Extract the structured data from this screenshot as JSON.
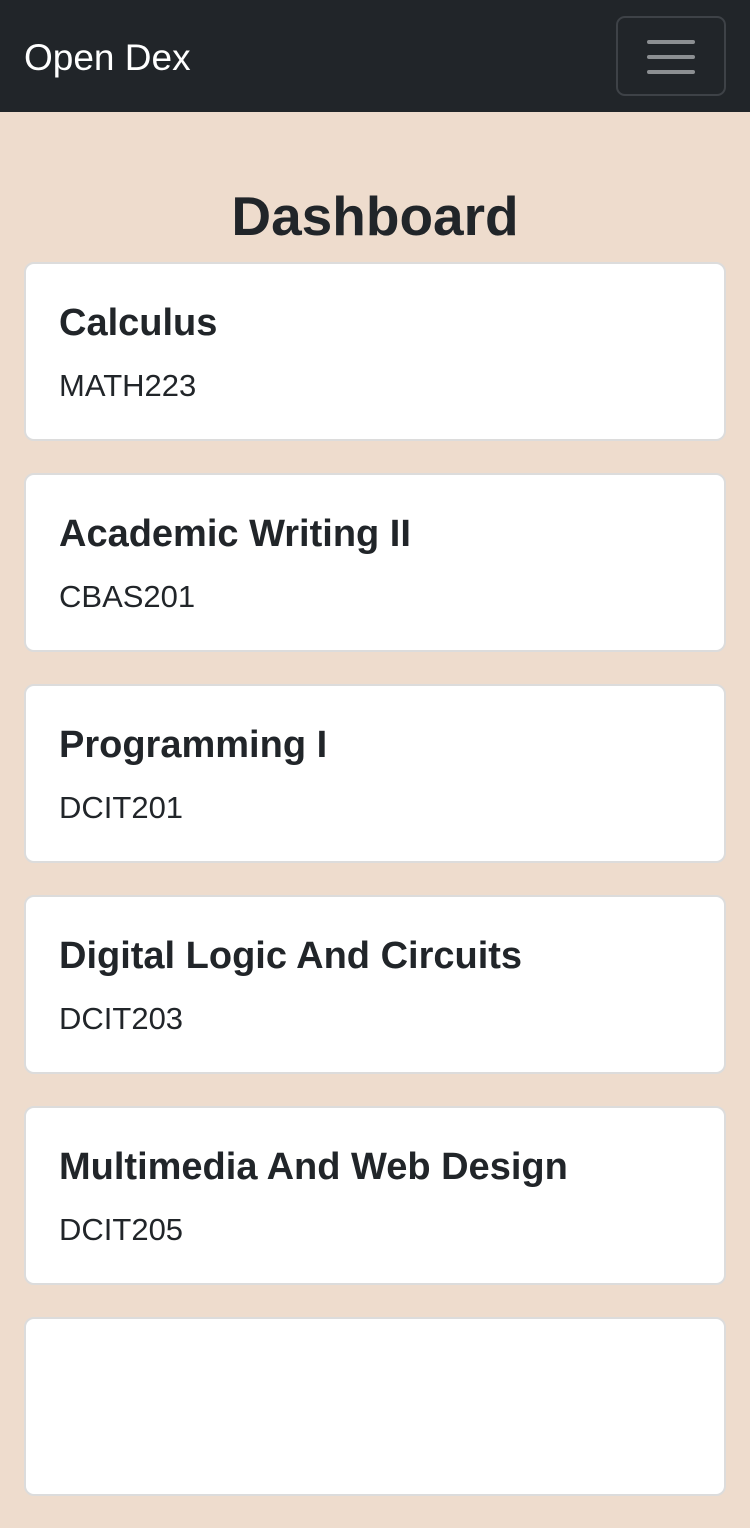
{
  "navbar": {
    "brand": "Open Dex",
    "toggle_icon": "hamburger-menu-icon"
  },
  "page": {
    "title": "Dashboard"
  },
  "courses": [
    {
      "name": "Calculus",
      "code": "MATH223"
    },
    {
      "name": "Academic Writing II",
      "code": "CBAS201"
    },
    {
      "name": "Programming I",
      "code": "DCIT201"
    },
    {
      "name": "Digital Logic And Circuits",
      "code": "DCIT203"
    },
    {
      "name": "Multimedia And Web Design",
      "code": "DCIT205"
    },
    {
      "name": "",
      "code": ""
    }
  ],
  "colors": {
    "navbar_bg": "#212529",
    "page_bg": "#eedccd",
    "card_bg": "#ffffff",
    "text": "#212529"
  }
}
